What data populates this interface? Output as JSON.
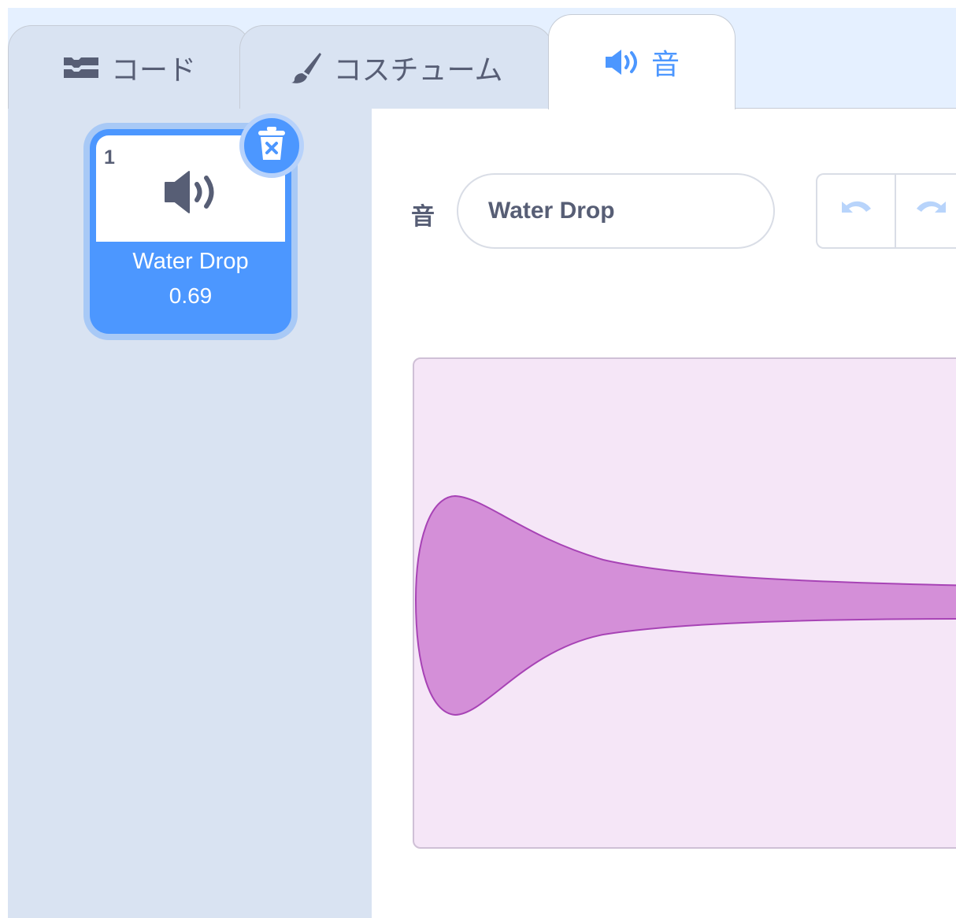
{
  "tabs": [
    {
      "label": "コード",
      "icon": "code-blocks-icon",
      "selected": false
    },
    {
      "label": "コスチューム",
      "icon": "paintbrush-icon",
      "selected": false
    },
    {
      "label": "音",
      "icon": "speaker-icon",
      "selected": true
    }
  ],
  "sound_list": {
    "items": [
      {
        "index": "1",
        "name": "Water Drop",
        "duration": "0.69",
        "icon": "speaker-icon",
        "selected": true
      }
    ],
    "delete_icon": "trash-delete-icon"
  },
  "editor": {
    "name_label": "音",
    "name_value": "Water Drop",
    "undo_icon": "undo-icon",
    "redo_icon": "redo-icon",
    "waveform": {
      "shape": "decaying-drop",
      "fill_color": "#d48fd8",
      "stroke_color": "#a743b5",
      "background": "#f5e6f7"
    }
  },
  "colors": {
    "accent": "#4c97ff",
    "tab_inactive_bg": "#d9e3f2",
    "text": "#575e75"
  }
}
